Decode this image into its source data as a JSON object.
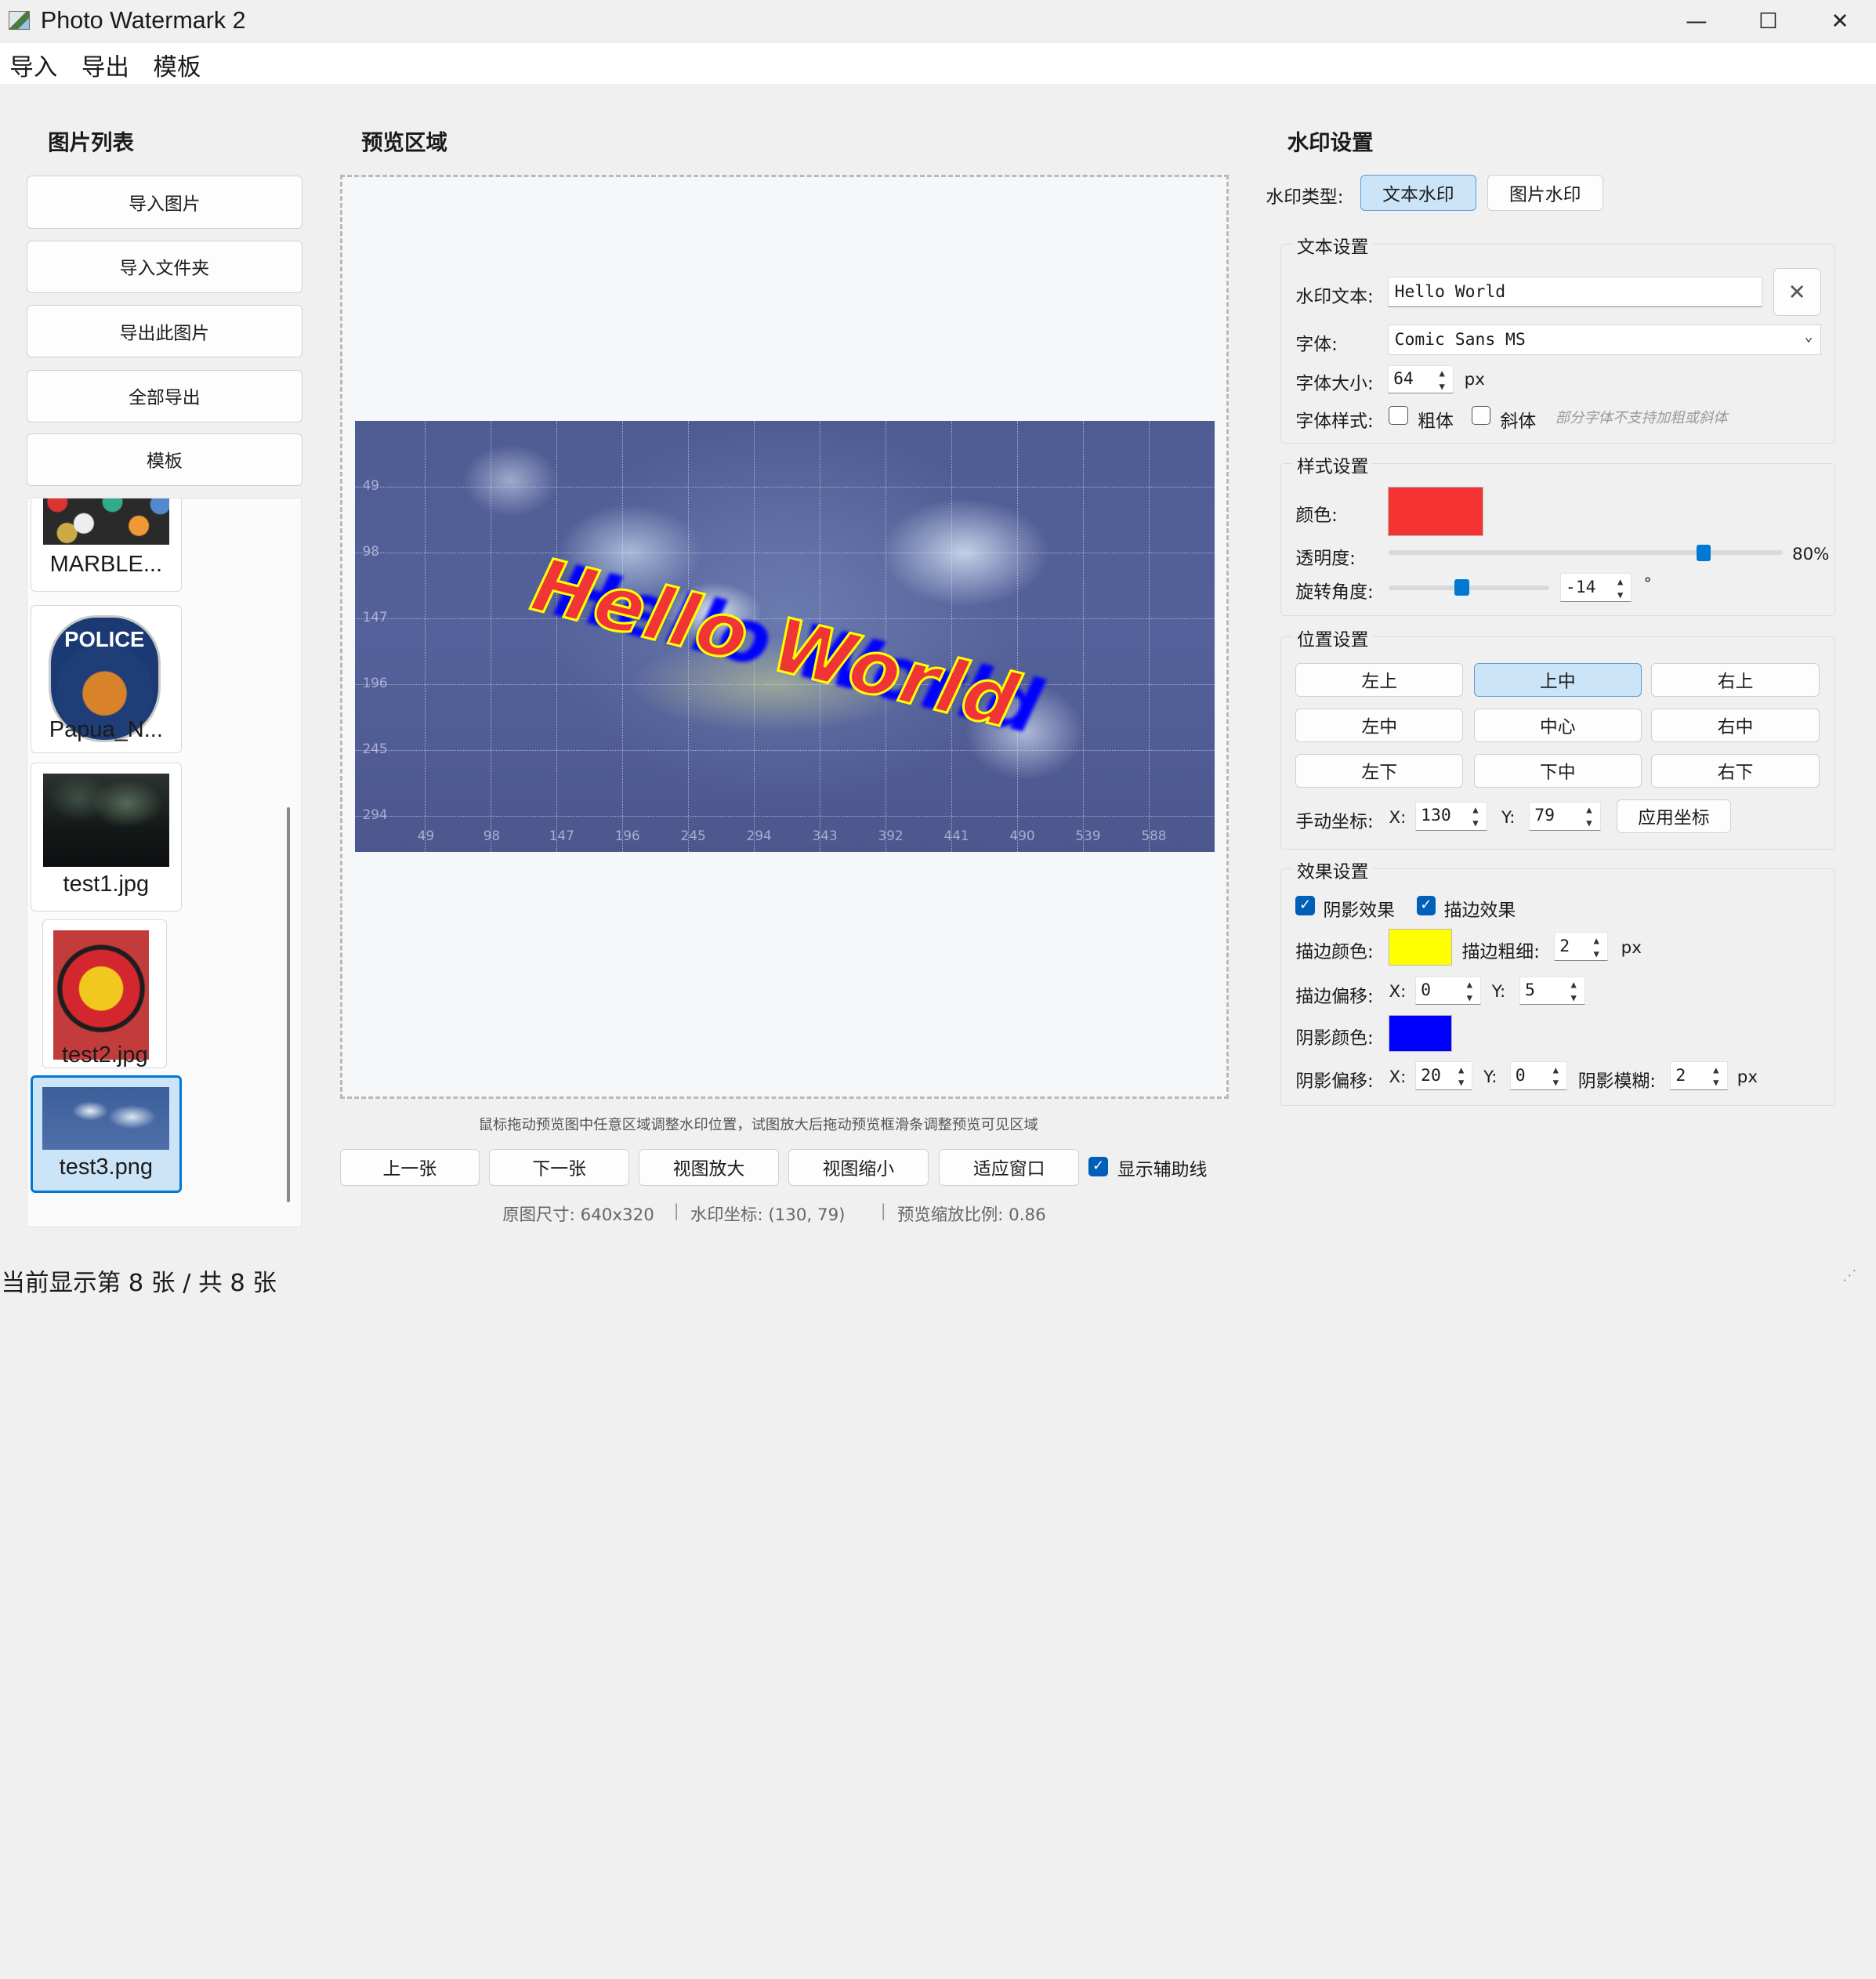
{
  "window": {
    "title": "Photo Watermark 2",
    "controls": {
      "minimize": "—",
      "maximize": "☐",
      "close": "✕"
    }
  },
  "menu": [
    "导入",
    "导出",
    "模板"
  ],
  "left": {
    "title": "图片列表",
    "buttons": [
      "导入图片",
      "导入文件夹",
      "导出此图片",
      "全部导出",
      "模板"
    ],
    "thumbs": [
      {
        "name": "MARBLE...",
        "icon": "marbles-thumbnail"
      },
      {
        "name": "Papua_N...",
        "icon": "police-badge-thumbnail"
      },
      {
        "name": "test1.jpg",
        "icon": "dark-photo-thumbnail"
      },
      {
        "name": "test2.jpg",
        "icon": "target-thumbnail"
      },
      {
        "name": "test3.png",
        "icon": "satellite-thumbnail"
      }
    ]
  },
  "preview": {
    "title": "预览区域",
    "watermark_text": "Hello World",
    "grid_x_labels": [
      "49",
      "98",
      "147",
      "196",
      "245",
      "294",
      "343",
      "392",
      "441",
      "490",
      "539",
      "588"
    ],
    "grid_y_labels": [
      "49",
      "98",
      "147",
      "196",
      "245",
      "294"
    ],
    "hint": "鼠标拖动预览图中任意区域调整水印位置，试图放大后拖动预览框滑条调整预览可见区域",
    "buttons": [
      "上一张",
      "下一张",
      "视图放大",
      "视图缩小",
      "适应窗口"
    ],
    "show_guides_label": "显示辅助线",
    "info": {
      "size": "原图尺寸: 640x320",
      "coord": "水印坐标: (130, 79)",
      "scale": "预览缩放比例: 0.86",
      "sep": "|"
    }
  },
  "settings": {
    "title": "水印设置",
    "type_label": "水印类型:",
    "type_buttons": [
      "文本水印",
      "图片水印"
    ],
    "text_group": {
      "title": "文本设置",
      "text_label": "水印文本:",
      "text_value": "Hello World",
      "clear_icon": "✕",
      "font_label": "字体:",
      "font_value": "Comic Sans MS",
      "size_label": "字体大小:",
      "size_value": "64",
      "size_unit": "px",
      "style_label": "字体样式:",
      "bold_label": "粗体",
      "italic_label": "斜体",
      "style_hint": "部分字体不支持加粗或斜体"
    },
    "style_group": {
      "title": "样式设置",
      "color_label": "颜色:",
      "color": "#f53333",
      "opacity_label": "透明度:",
      "opacity_value": "80%",
      "opacity_fraction": 0.8,
      "rotation_label": "旋转角度:",
      "rotation_value": "-14",
      "rotation_unit": "°"
    },
    "position_group": {
      "title": "位置设置",
      "grid": [
        "左上",
        "上中",
        "右上",
        "左中",
        "中心",
        "右中",
        "左下",
        "下中",
        "右下"
      ],
      "manual_label": "手动坐标:",
      "x_label": "X:",
      "x_value": "130",
      "y_label": "Y:",
      "y_value": "79",
      "apply_label": "应用坐标"
    },
    "effect_group": {
      "title": "效果设置",
      "shadow_label": "阴影效果",
      "stroke_label": "描边效果",
      "stroke_color_label": "描边颜色:",
      "stroke_color": "#ffff00",
      "stroke_width_label": "描边粗细:",
      "stroke_width_value": "2",
      "px": "px",
      "stroke_offset_label": "描边偏移:",
      "x_label": "X:",
      "y_label": "Y:",
      "stroke_offset_x": "0",
      "stroke_offset_y": "5",
      "shadow_color_label": "阴影颜色:",
      "shadow_color": "#0000ff",
      "shadow_offset_label": "阴影偏移:",
      "shadow_offset_x": "20",
      "shadow_offset_y": "0",
      "shadow_blur_label": "阴影模糊:",
      "shadow_blur_value": "2"
    }
  },
  "status": "当前显示第 8 张 / 共 8 张"
}
